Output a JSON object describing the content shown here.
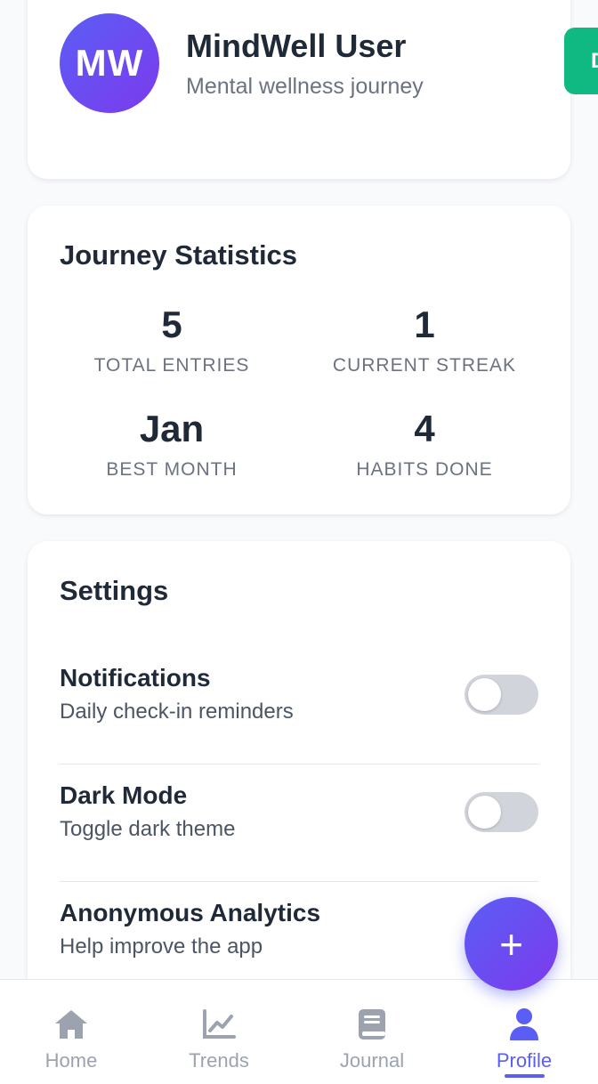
{
  "profile": {
    "avatar_initials": "MW",
    "name": "MindWell User",
    "subtitle": "Mental wellness journey",
    "edge_button_label": "D"
  },
  "stats": {
    "title": "Journey Statistics",
    "items": [
      {
        "value": "5",
        "label": "TOTAL ENTRIES"
      },
      {
        "value": "1",
        "label": "CURRENT STREAK"
      },
      {
        "value": "Jan",
        "label": "BEST MONTH"
      },
      {
        "value": "4",
        "label": "HABITS DONE"
      }
    ]
  },
  "settings": {
    "title": "Settings",
    "items": [
      {
        "name": "Notifications",
        "description": "Daily check-in reminders",
        "enabled": false
      },
      {
        "name": "Dark Mode",
        "description": "Toggle dark theme",
        "enabled": false
      },
      {
        "name": "Anonymous Analytics",
        "description": "Help improve the app",
        "enabled": false
      }
    ]
  },
  "fab": {
    "label": "+"
  },
  "nav": {
    "items": [
      {
        "label": "Home",
        "icon": "home-icon",
        "active": false
      },
      {
        "label": "Trends",
        "icon": "chart-line-icon",
        "active": false
      },
      {
        "label": "Journal",
        "icon": "book-icon",
        "active": false
      },
      {
        "label": "Profile",
        "icon": "user-icon",
        "active": true
      }
    ]
  },
  "colors": {
    "accent": "#5b5ef5",
    "accent_secondary": "#7c3aed",
    "success": "#10b981",
    "inactive": "#9ca3af"
  }
}
